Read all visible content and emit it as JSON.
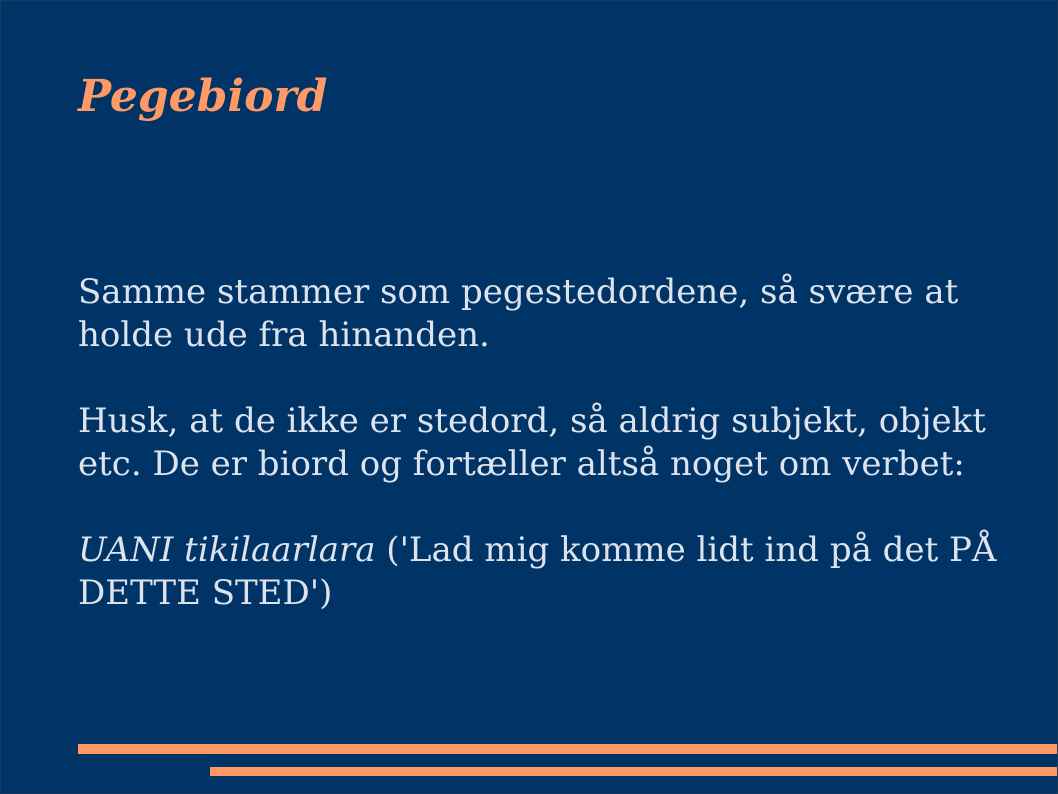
{
  "slide": {
    "title": "Pegebiord",
    "paragraph_1": "Samme stammer som pegestedordene, så svære at holde ude fra hinanden.",
    "paragraph_2": "Husk, at de ikke er stedord, så aldrig subjekt, objekt etc. De er biord og fortæller altså noget om verbet:",
    "example_term": "UANI tikilaarlara",
    "example_translation": " ('Lad mig komme lidt ind på det PÅ DETTE STED')"
  },
  "colors": {
    "background": "#003366",
    "accent": "#ff9966",
    "text": "#dde3ec"
  }
}
